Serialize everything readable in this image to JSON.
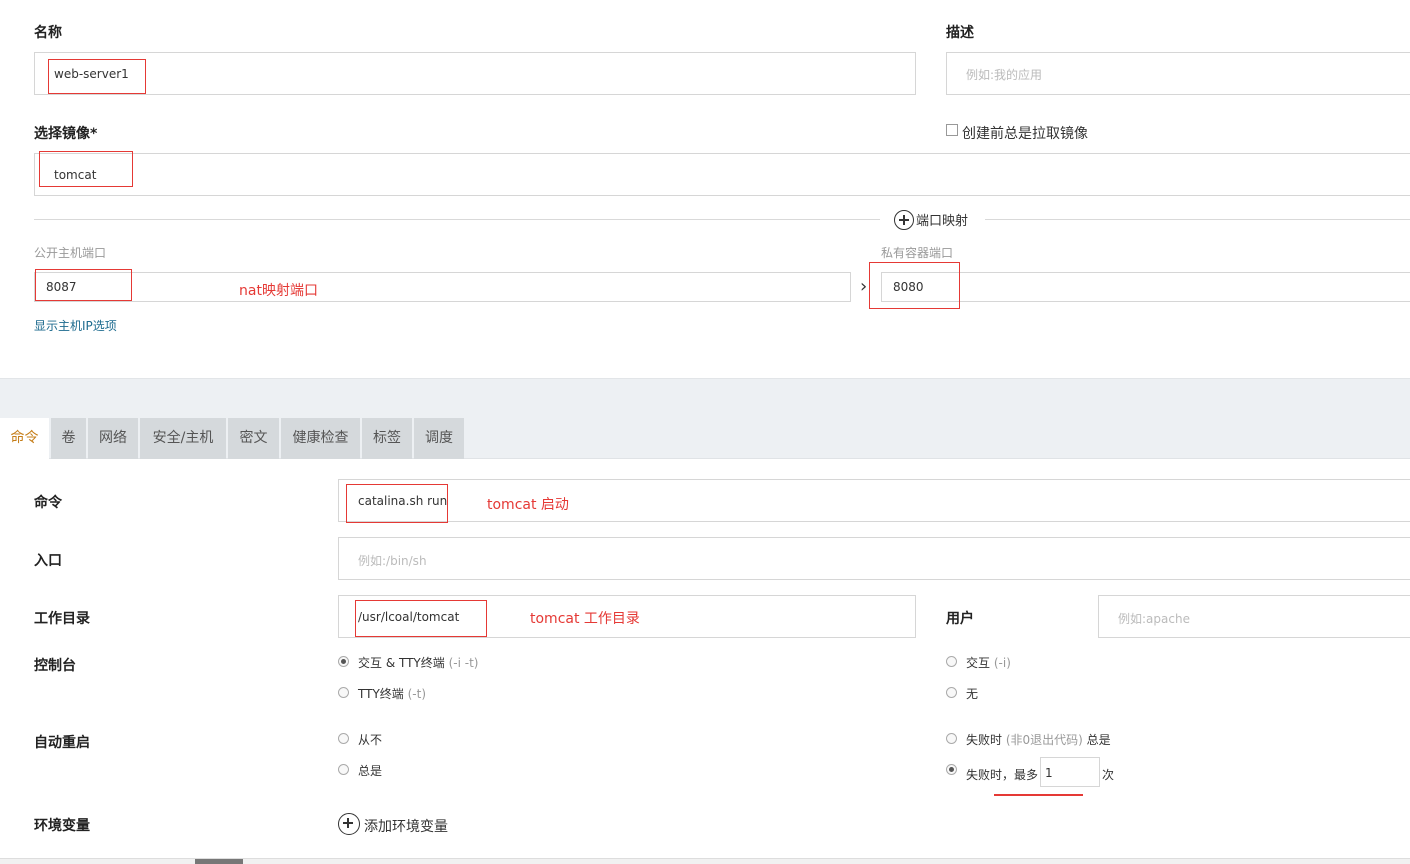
{
  "name_field": {
    "label": "名称",
    "value": "web-server1"
  },
  "desc_field": {
    "label": "描述",
    "placeholder": "例如:我的应用"
  },
  "image_field": {
    "label": "选择镜像*",
    "value": "tomcat"
  },
  "pull_checkbox": {
    "label": "创建前总是拉取镜像",
    "checked": false
  },
  "port_mapping": {
    "add_label": "端口映射",
    "public_label": "公开主机端口",
    "public_value": "8087",
    "private_label": "私有容器端口",
    "private_value": "8080",
    "arrow": "›",
    "show_ip_link": "显示主机IP选项"
  },
  "annotations": {
    "nat": "nat映射端口",
    "tomcat_start": "tomcat 启动",
    "tomcat_workdir": "tomcat 工作目录"
  },
  "tabs": [
    {
      "label": "命令",
      "active": true
    },
    {
      "label": "卷"
    },
    {
      "label": "网络"
    },
    {
      "label": "安全/主机"
    },
    {
      "label": "密文"
    },
    {
      "label": "健康检查"
    },
    {
      "label": "标签"
    },
    {
      "label": "调度"
    }
  ],
  "command": {
    "label": "命令",
    "value": "catalina.sh run"
  },
  "entrypoint": {
    "label": "入口",
    "placeholder": "例如:/bin/sh"
  },
  "workdir": {
    "label": "工作目录",
    "value": "/usr/lcoal/tomcat"
  },
  "user": {
    "label": "用户",
    "placeholder": "例如:apache"
  },
  "console": {
    "label": "控制台",
    "options": [
      {
        "text": "交互 & TTY终端",
        "hint": "(-i -t)",
        "selected": true
      },
      {
        "text": "TTY终端",
        "hint": "(-t)",
        "selected": false
      },
      {
        "text": "交互",
        "hint": "(-i)",
        "selected": false
      },
      {
        "text": "无",
        "hint": "",
        "selected": false
      }
    ]
  },
  "restart": {
    "label": "自动重启",
    "options": [
      {
        "text": "从不",
        "selected": false
      },
      {
        "text": "总是",
        "selected": false
      },
      {
        "text": "失败时",
        "hint": "(非0退出代码)",
        "suffix": "总是",
        "selected": false
      },
      {
        "text": "失败时，最多",
        "selected": true
      }
    ],
    "max_retries": "1",
    "times_unit": "次"
  },
  "env": {
    "label": "环境变量",
    "add_label": "添加环境变量"
  }
}
